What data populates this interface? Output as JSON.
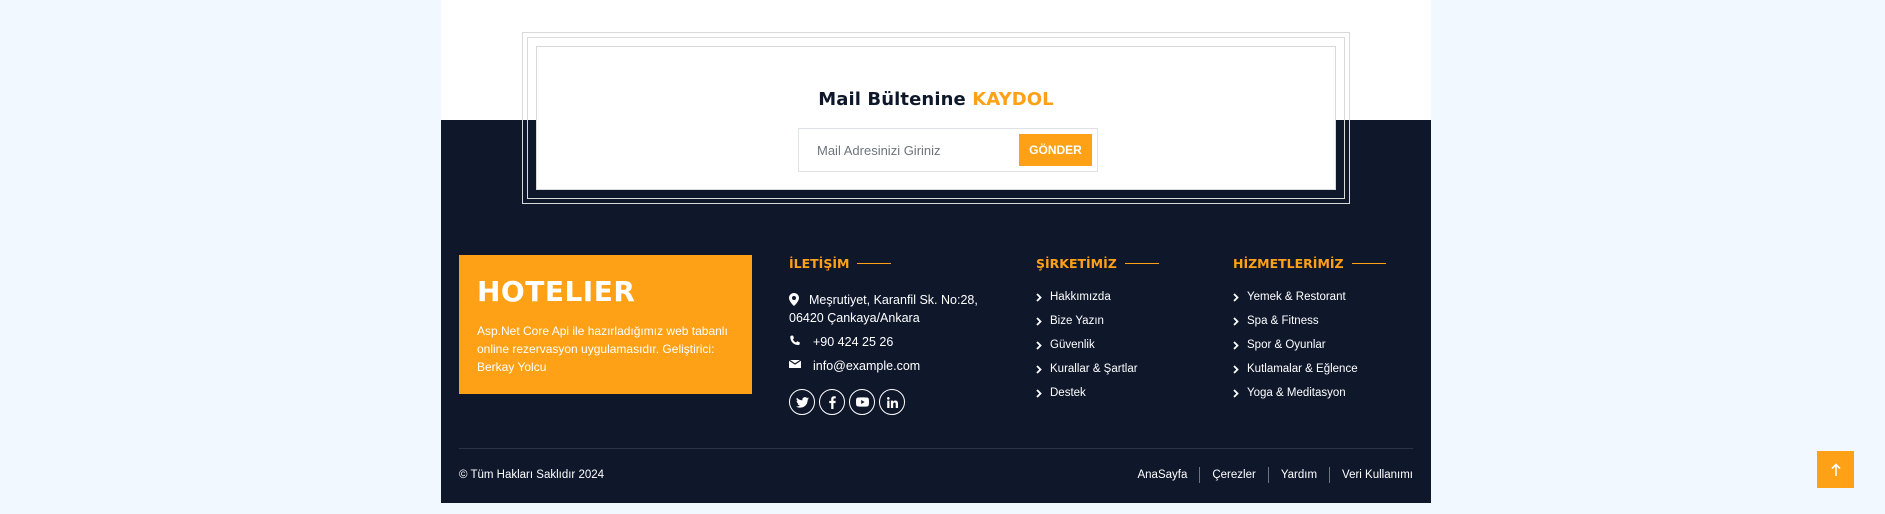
{
  "newsletter": {
    "title_main": "Mail Bültenine",
    "title_accent": "KAYDOL",
    "input_placeholder": "Mail Adresinizi Giriniz",
    "button_label": "GÖNDER"
  },
  "brand": {
    "name": "HOTELIER",
    "description": "Asp.Net Core Api ile hazırladığımız web tabanlı online rezervasyon uygulamasıdır. Geliştirici: Berkay Yolcu"
  },
  "contact": {
    "title": "İLETİŞİM",
    "address_line1": "Meşrutiyet, Karanfil Sk. No:28,",
    "address_line2": "06420 Çankaya/Ankara",
    "phone": "+90 424 25 26",
    "email": "info@example.com",
    "social": [
      "twitter-icon",
      "facebook-icon",
      "youtube-icon",
      "linkedin-icon"
    ]
  },
  "company": {
    "title": "ŞİRKETİMİZ",
    "links": [
      "Hakkımızda",
      "Bize Yazın",
      "Güvenlik",
      "Kurallar & Şartlar",
      "Destek"
    ]
  },
  "services": {
    "title": "HİZMETLERİMİZ",
    "links": [
      "Yemek & Restorant",
      "Spa & Fitness",
      "Spor & Oyunlar",
      "Kutlamalar & Eğlence",
      "Yoga & Meditasyon"
    ]
  },
  "bottom": {
    "copyright": "© Tüm Hakları Saklıdır 2024",
    "links": [
      "AnaSayfa",
      "Çerezler",
      "Yardım",
      "Veri Kullanımı"
    ]
  },
  "colors": {
    "accent": "#fea116",
    "dark": "#0f172b",
    "page_bg": "#f1f8ff"
  }
}
